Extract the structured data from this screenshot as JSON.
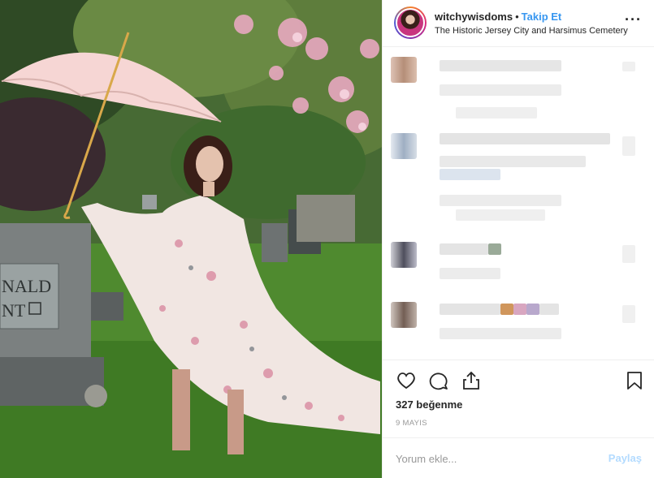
{
  "post": {
    "username": "witchywisdoms",
    "separator": "•",
    "follow_label": "Takip Et",
    "location": "The Historic Jersey City and Harsimus Cemetery",
    "more_icon": "more-options-icon",
    "likes": "327 beğenme",
    "date": "9 MAYIS"
  },
  "photo": {
    "headstone_text_line1": "NALD",
    "headstone_text_line2": "NT"
  },
  "actions": {
    "icons": [
      "heart-icon",
      "comment-icon",
      "share-icon",
      "bookmark-icon"
    ]
  },
  "comment": {
    "placeholder": "Yorum ekle...",
    "post_label": "Paylaş"
  },
  "colors": {
    "link_blue": "#3897f0",
    "post_disabled": "#b3dbff",
    "border": "#efefef"
  }
}
